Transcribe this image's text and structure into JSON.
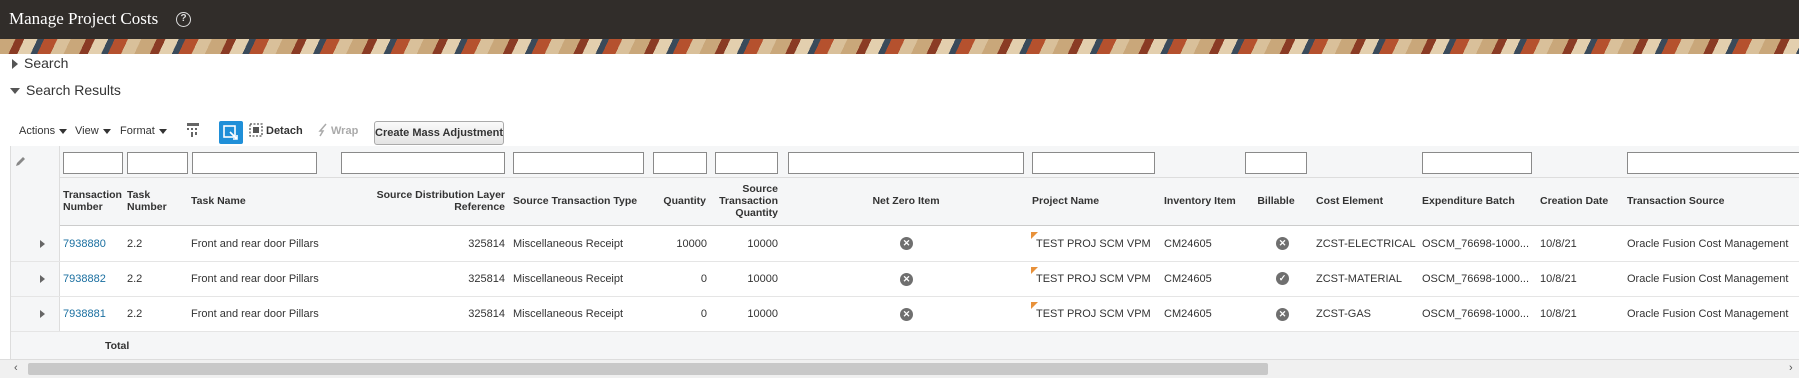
{
  "header": {
    "title": "Manage Project Costs",
    "help_glyph": "?"
  },
  "sections": {
    "search_label": "Search",
    "results_label": "Search Results"
  },
  "toolbar": {
    "actions_label": "Actions",
    "view_label": "View",
    "format_label": "Format",
    "detach_label": "Detach",
    "wrap_label": "Wrap",
    "mass_adjust_label": "Create Mass Adjustment"
  },
  "table": {
    "columns": {
      "transaction_number": "Transaction Number",
      "task_number": "Task Number",
      "task_name": "Task Name",
      "source_distribution_layer_reference": "Source Distribution Layer Reference",
      "source_transaction_type": "Source Transaction Type",
      "quantity": "Quantity",
      "source_transaction_quantity": "Source Transaction Quantity",
      "net_zero_item": "Net Zero Item",
      "project_name": "Project Name",
      "inventory_item": "Inventory Item",
      "billable": "Billable",
      "cost_element": "Cost Element",
      "expenditure_batch": "Expenditure Batch",
      "creation_date": "Creation Date",
      "transaction_source": "Transaction Source"
    },
    "rows": [
      {
        "transaction_number": "7938880",
        "task_number": "2.2",
        "task_name": "Front and rear door Pillars",
        "source_ref": "325814",
        "source_type": "Miscellaneous Receipt",
        "quantity": "10000",
        "source_qty": "10000",
        "net_zero": "no",
        "project_name": "TEST PROJ SCM VPM",
        "inventory_item": "CM24605",
        "billable": "no",
        "cost_element": "ZCST-ELECTRICAL",
        "expenditure_batch": "OSCM_76698-1000...",
        "creation_date": "10/8/21",
        "transaction_source": "Oracle Fusion Cost Management"
      },
      {
        "transaction_number": "7938882",
        "task_number": "2.2",
        "task_name": "Front and rear door Pillars",
        "source_ref": "325814",
        "source_type": "Miscellaneous Receipt",
        "quantity": "0",
        "source_qty": "10000",
        "net_zero": "no",
        "project_name": "TEST PROJ SCM VPM",
        "inventory_item": "CM24605",
        "billable": "yes",
        "cost_element": "ZCST-MATERIAL",
        "expenditure_batch": "OSCM_76698-1000...",
        "creation_date": "10/8/21",
        "transaction_source": "Oracle Fusion Cost Management"
      },
      {
        "transaction_number": "7938881",
        "task_number": "2.2",
        "task_name": "Front and rear door Pillars",
        "source_ref": "325814",
        "source_type": "Miscellaneous Receipt",
        "quantity": "0",
        "source_qty": "10000",
        "net_zero": "no",
        "project_name": "TEST PROJ SCM VPM",
        "inventory_item": "CM24605",
        "billable": "no",
        "cost_element": "ZCST-GAS",
        "expenditure_batch": "OSCM_76698-1000...",
        "creation_date": "10/8/21",
        "transaction_source": "Oracle Fusion Cost Management"
      }
    ],
    "total_label": "Total"
  },
  "icons": {
    "no_glyph": "✕",
    "yes_glyph": "✓",
    "scroll_left_glyph": "‹",
    "scroll_right_glyph": "›"
  },
  "colors": {
    "titlebar": "#312d2a",
    "link": "#1a6fa0",
    "primary_button": "#1f8fd8",
    "flag": "#e8913a"
  }
}
